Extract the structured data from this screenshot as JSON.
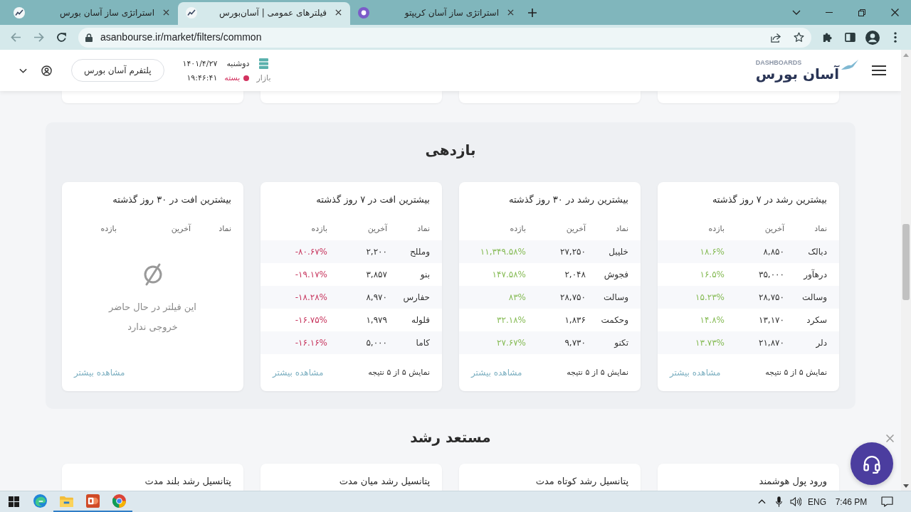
{
  "browser": {
    "tabs": [
      {
        "title": "استراتژی ساز آسان کریپتو",
        "kind": "crypto",
        "selected": false
      },
      {
        "title": "فیلترهای عمومی | آسان‌بورس",
        "kind": "bourse",
        "selected": true
      },
      {
        "title": "استراتژی ساز آسان بورس",
        "kind": "bourse",
        "selected": false
      }
    ],
    "back": {
      "disabled": true
    },
    "forward": {
      "disabled": true
    },
    "url": "asanbourse.ir/market/filters/common"
  },
  "header": {
    "logo": {
      "name": "آسان بورس",
      "tagline": "DASHBOARDS"
    },
    "date": {
      "weekday": "دوشنبه",
      "date": "۱۴۰۱/۴/۲۷"
    },
    "market": {
      "label": "بازار",
      "status": "بسته",
      "open": false,
      "time": "۱۹:۴۶:۴۱"
    },
    "platform_button": "پلتفرم آسان بورس"
  },
  "sections": [
    {
      "title": "بازدهی",
      "kind": "shaded",
      "cards": [
        {
          "title": "بیشترین رشد در ۷ روز گذشته",
          "negative": false,
          "columns": [
            "نماد",
            "آخرین",
            "بازده"
          ],
          "rows": [
            {
              "symbol": "دبالک",
              "last": "۸,۸۵۰",
              "change": "۱۸.۶%"
            },
            {
              "symbol": "درهآور",
              "last": "۳۵,۰۰۰",
              "change": "۱۶.۵%"
            },
            {
              "symbol": "وسالت",
              "last": "۲۸,۷۵۰",
              "change": "۱۵.۲۳%"
            },
            {
              "symbol": "سکرد",
              "last": "۱۳,۱۷۰",
              "change": "۱۴.۸%"
            },
            {
              "symbol": "دلر",
              "last": "۲۱,۸۷۰",
              "change": "۱۳.۷۳%"
            }
          ],
          "result_count": "نمایش ۵ از ۵ نتیجه",
          "more_link": "مشاهده بیشتر"
        },
        {
          "title": "بیشترین رشد در ۳۰ روز گذشته",
          "negative": false,
          "columns": [
            "نماد",
            "آخرین",
            "بازده"
          ],
          "rows": [
            {
              "symbol": "خلیبل",
              "last": "۲۷,۲۵۰",
              "change": "۱۱,۳۴۹.۵۸%"
            },
            {
              "symbol": "فجوش",
              "last": "۲,۰۴۸",
              "change": "۱۴۷.۵۸%"
            },
            {
              "symbol": "وسالت",
              "last": "۲۸,۷۵۰",
              "change": "۸۳%"
            },
            {
              "symbol": "وحکمت",
              "last": "۱,۸۳۶",
              "change": "۳۲.۱۸%"
            },
            {
              "symbol": "تکنو",
              "last": "۹,۷۳۰",
              "change": "۲۷.۶۷%"
            }
          ],
          "result_count": "نمایش ۵ از ۵ نتیجه",
          "more_link": "مشاهده بیشتر"
        },
        {
          "title": "بیشترین افت در ۷ روز گذشته",
          "negative": true,
          "columns": [
            "نماد",
            "آخرین",
            "بازده"
          ],
          "rows": [
            {
              "symbol": "ومللح",
              "last": "۲,۲۰۰",
              "change": "-۸۰.۶۷%"
            },
            {
              "symbol": "بنو",
              "last": "۳,۸۵۷",
              "change": "-۱۹.۱۷%"
            },
            {
              "symbol": "حفارس",
              "last": "۸,۹۷۰",
              "change": "-۱۸.۲۸%"
            },
            {
              "symbol": "فلوله",
              "last": "۱,۹۷۹",
              "change": "-۱۶.۷۵%"
            },
            {
              "symbol": "کاما",
              "last": "۵,۰۰۰",
              "change": "-۱۶.۱۶%"
            }
          ],
          "result_count": "نمایش ۵ از ۵ نتیجه",
          "more_link": "مشاهده بیشتر"
        },
        {
          "title": "بیشترین افت در ۳۰ روز گذشته",
          "columns": [
            "نماد",
            "آخرین",
            "بازده"
          ],
          "empty_message": "این فیلتر در حال حاضر خروجی ندارد",
          "more_link": "مشاهده بیشتر"
        }
      ]
    },
    {
      "title": "مستعد رشد",
      "kind": "plain",
      "cards": [
        {
          "title": "ورود پول هوشمند"
        },
        {
          "title": "پتانسیل رشد کوتاه مدت"
        },
        {
          "title": "پتانسیل رشد میان مدت"
        },
        {
          "title": "پتانسیل رشد بلند مدت"
        }
      ]
    }
  ],
  "taskbar": {
    "apps": [
      {
        "kind": "edge",
        "running": false
      },
      {
        "kind": "explorer",
        "running": true
      },
      {
        "kind": "powerpoint",
        "running": true
      },
      {
        "kind": "chrome",
        "running": true
      }
    ],
    "language": "ENG",
    "time": "7:46 PM"
  }
}
